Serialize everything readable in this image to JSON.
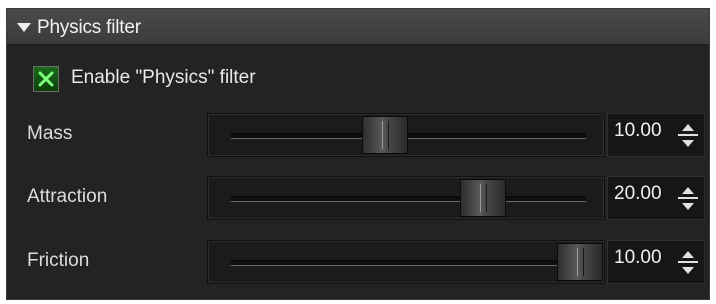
{
  "panel": {
    "title": "Physics filter",
    "collapse_icon": "triangle-down-icon"
  },
  "enable": {
    "label": "Enable \"Physics\" filter",
    "checked": true,
    "check_icon": "x-check-icon"
  },
  "params": [
    {
      "label": "Mass",
      "value": "10.00",
      "slider_fraction": 0.44
    },
    {
      "label": "Attraction",
      "value": "20.00",
      "slider_fraction": 0.72
    },
    {
      "label": "Friction",
      "value": "10.00",
      "slider_fraction": 1.0
    }
  ],
  "colors": {
    "background": "#232323",
    "header": "#3b3b3b",
    "checkbox_green": "#1c6b1c"
  }
}
